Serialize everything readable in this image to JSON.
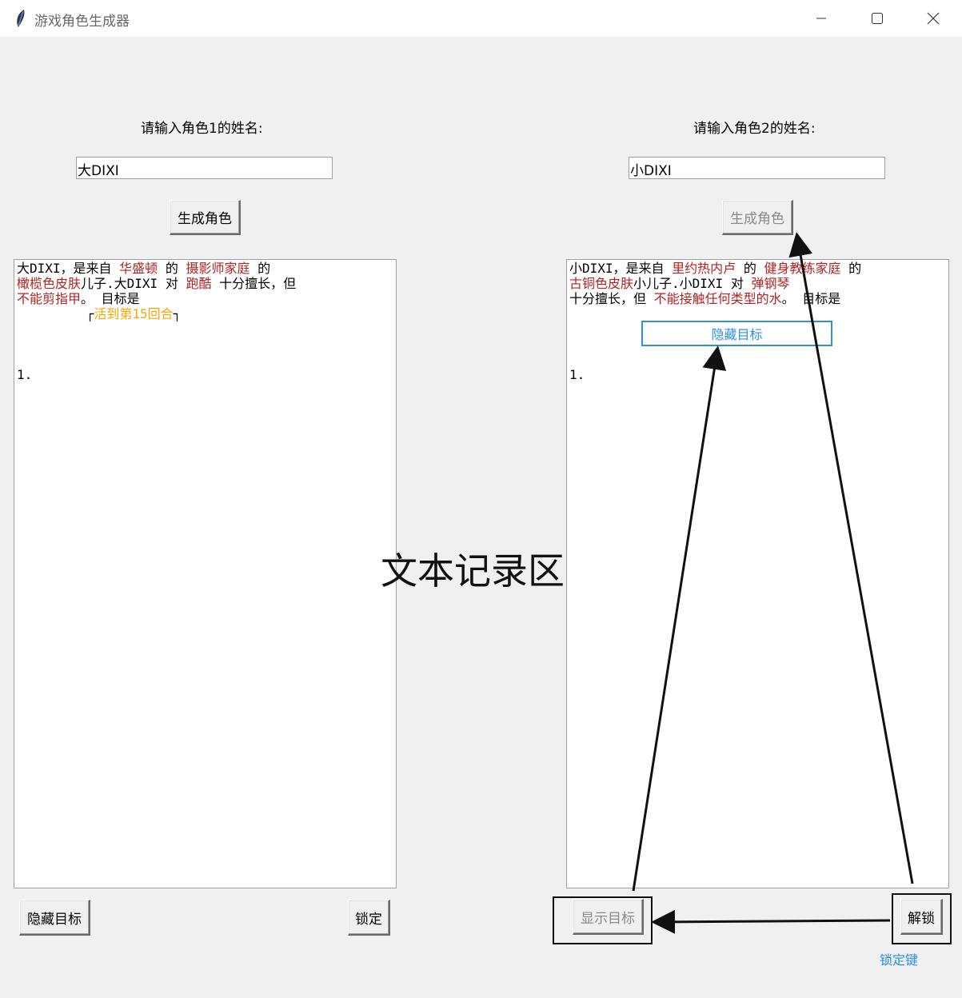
{
  "window": {
    "title": "游戏角色生成器"
  },
  "left": {
    "prompt": "请输入角色1的姓名:",
    "name_value": "大DIXI",
    "generate_label": "生成角色",
    "text_lines": [
      [
        {
          "t": "大DIXI，是来自 "
        },
        {
          "t": "华盛顿",
          "c": "red"
        },
        {
          "t": " 的 "
        },
        {
          "t": "摄影师家庭",
          "c": "red"
        },
        {
          "t": " 的"
        }
      ],
      [
        {
          "t": "橄榄色皮肤",
          "c": "red"
        },
        {
          "t": "儿子.大DIXI 对 "
        },
        {
          "t": "跑酷",
          "c": "red"
        },
        {
          "t": " 十分擅长，但"
        }
      ],
      [
        {
          "t": "不能剪指甲",
          "c": "red"
        },
        {
          "t": "。 目标是"
        }
      ],
      [
        {
          "t": "         ┌"
        },
        {
          "t": "活到第15回合",
          "c": "orange"
        },
        {
          "t": "┐"
        }
      ],
      [
        {
          "t": " "
        }
      ],
      [
        {
          "t": " "
        }
      ],
      [
        {
          "t": " "
        }
      ],
      [
        {
          "t": "1."
        }
      ]
    ],
    "hide_goal_label": "隐藏目标",
    "lock_label": "锁定"
  },
  "right": {
    "prompt": "请输入角色2的姓名:",
    "name_value": "小DIXI",
    "generate_label": "生成角色",
    "text_lines": [
      [
        {
          "t": "小DIXI，是来自 "
        },
        {
          "t": "里约热内卢",
          "c": "red"
        },
        {
          "t": " 的 "
        },
        {
          "t": "健身教练家庭",
          "c": "red"
        },
        {
          "t": " 的"
        }
      ],
      [
        {
          "t": "古铜色皮肤",
          "c": "red"
        },
        {
          "t": "小儿子.小DIXI 对 "
        },
        {
          "t": "弹钢琴",
          "c": "red"
        }
      ],
      [
        {
          "t": "十分擅长，但 "
        },
        {
          "t": "不能接触任何类型的水",
          "c": "red"
        },
        {
          "t": "。 目标是"
        }
      ],
      [
        {
          "t": " "
        }
      ],
      [
        {
          "t": " "
        }
      ],
      [
        {
          "t": " "
        }
      ],
      [
        {
          "t": " "
        }
      ],
      [
        {
          "t": "1."
        }
      ]
    ],
    "goal_placeholder": "隐藏目标",
    "show_goal_label": "显示目标",
    "unlock_label": "解锁"
  },
  "annotations": {
    "center_label": "文本记录区",
    "lock_key_caption": "锁定键"
  },
  "colors": {
    "emphasis": "#b22222",
    "goal": "#ffa500",
    "annotation_blue": "#2e8fe0"
  }
}
